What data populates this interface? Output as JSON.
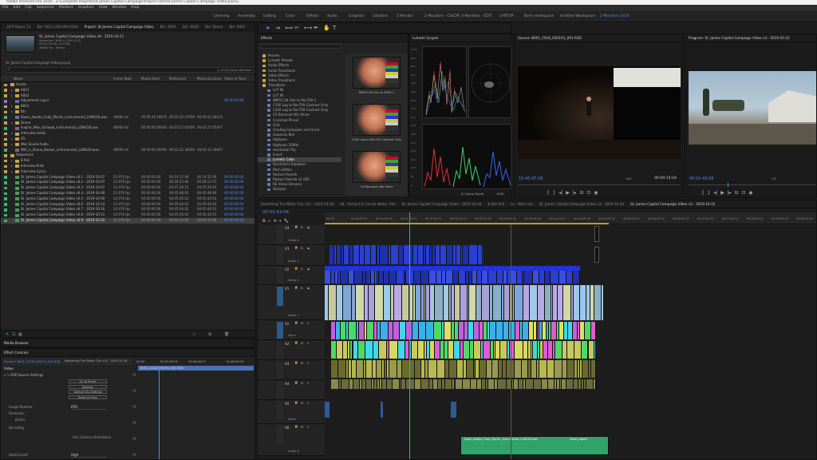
{
  "window": {
    "title": "Adobe Premiere Pro 2019 - Z:\\Complete Projects\\St James Capital Campaign\\Project Files\\St James Capital Campaign Video.prproj"
  },
  "menu": [
    "File",
    "Edit",
    "Clip",
    "Sequence",
    "Markers",
    "Graphics",
    "View",
    "Window",
    "Help"
  ],
  "workspaces": [
    {
      "label": "Learning",
      "active": false
    },
    {
      "label": "Assembly",
      "active": false
    },
    {
      "label": "Editing",
      "active": false
    },
    {
      "label": "Color",
      "active": false
    },
    {
      "label": "Effects",
      "active": false
    },
    {
      "label": "Audio",
      "active": false
    },
    {
      "label": "Graphics",
      "active": false
    },
    {
      "label": "Libraries",
      "active": false
    },
    {
      "label": "2 Monitor",
      "active": false
    },
    {
      "label": "2 Monitors - COLOR",
      "active": false
    },
    {
      "label": "3 Monitors - EDIT",
      "active": false
    },
    {
      "label": "LAPTOP",
      "active": false
    },
    {
      "label": "Tom's workspace",
      "active": false
    },
    {
      "label": "Untitled Workspace",
      "active": false
    },
    {
      "label": "2 Monitors 2019",
      "active": true
    }
  ],
  "project": {
    "tabs": [
      "...DCP Reduc 12",
      "Bin: A012_0913XH 0356",
      "Project: St James Capital Campaign Video",
      "Bin: A001",
      "Bin: A002",
      "Bin: Drone",
      "Bin: 0001"
    ],
    "active_tab": "Project: St James Capital Campaign Video",
    "preview_title": "St. James Capital Campaign Video v8 - 2019-10-21",
    "preview_info": [
      "Sequence, 3840 x 2160 (1.0)",
      "00:02:43:06, 23.976p",
      "48000 Hz - Stereo"
    ],
    "file_name": "St. James Capital Campaign Video.prproj",
    "count": "1 of 24 items selected",
    "headers": [
      "Name",
      "Frame Rate",
      "Media Start",
      "Media End",
      "Media Duration",
      "Video In Point"
    ],
    "rows": [
      {
        "name": "Assets",
        "type": "folder",
        "color": "#c9a24a",
        "indent": 0,
        "fr": "",
        "ms": "",
        "me": "",
        "md": "",
        "vi": ""
      },
      {
        "name": "A001",
        "type": "folder",
        "color": "#c9a24a",
        "indent": 1,
        "fr": "",
        "ms": "",
        "me": "",
        "md": "",
        "vi": ""
      },
      {
        "name": "A002",
        "type": "folder",
        "color": "#c9a24a",
        "indent": 1,
        "fr": "",
        "ms": "",
        "me": "",
        "md": "",
        "vi": ""
      },
      {
        "name": "Adjustment Layer",
        "type": "clip",
        "color": "#8b72c9",
        "indent": 1,
        "fr": "",
        "ms": "",
        "me": "",
        "md": "",
        "vi": "00:00:00:00"
      },
      {
        "name": "B001",
        "type": "folder",
        "color": "#c9a24a",
        "indent": 1,
        "fr": "",
        "ms": "",
        "me": "",
        "md": "",
        "vi": ""
      },
      {
        "name": "Bts",
        "type": "folder",
        "color": "#c9a24a",
        "indent": 1,
        "fr": "",
        "ms": "",
        "me": "",
        "md": "",
        "vi": ""
      },
      {
        "name": "Dawn_Awaits_Cody_Martin_instrumental_LONG29.wav",
        "type": "clip",
        "color": "#3bb56f",
        "indent": 1,
        "fr": "48000 Hz",
        "ms": "00:00:19:18870",
        "me": "00:03:12:47099",
        "md": "00:04:52:28124",
        "vi": ""
      },
      {
        "name": "Drone",
        "type": "folder",
        "color": "#c9a24a",
        "indent": 1,
        "fr": "",
        "ms": "",
        "me": "",
        "md": "",
        "vi": ""
      },
      {
        "name": "Inspire_Mike_Schwab_instrumental_LONG28.wav",
        "type": "clip",
        "color": "#3bb56f",
        "indent": 1,
        "fr": "48000 Hz",
        "ms": "00:00:00:00000",
        "me": "00:03:27:05406",
        "md": "00:03:27:05407",
        "vi": ""
      },
      {
        "name": "Interview Audio",
        "type": "folder",
        "color": "#c9a24a",
        "indent": 1,
        "fr": "",
        "ms": "",
        "me": "",
        "md": "",
        "vi": ""
      },
      {
        "name": "LTs",
        "type": "folder",
        "color": "#c9a24a",
        "indent": 1,
        "fr": "",
        "ms": "",
        "me": "",
        "md": "",
        "vi": ""
      },
      {
        "name": "Wes Sound Audio",
        "type": "folder",
        "color": "#c9a24a",
        "indent": 1,
        "fr": "",
        "ms": "",
        "me": "",
        "md": "",
        "vi": ""
      },
      {
        "name": "Will_in_Shane_Barber_instrumental_LONG29.wav",
        "type": "clip",
        "color": "#3bb56f",
        "indent": 1,
        "fr": "48000 Hz",
        "ms": "00:00:00:00000",
        "me": "00:03:15:36666",
        "md": "00:03:15:36667",
        "vi": ""
      },
      {
        "name": "Sequences",
        "type": "folder",
        "color": "#c9a24a",
        "indent": 0,
        "fr": "",
        "ms": "",
        "me": "",
        "md": "",
        "vi": ""
      },
      {
        "name": "B Roll",
        "type": "folder",
        "color": "#c9a24a",
        "indent": 1,
        "fr": "",
        "ms": "",
        "me": "",
        "md": "",
        "vi": ""
      },
      {
        "name": "Interview Pulls",
        "type": "folder",
        "color": "#c9a24a",
        "indent": 1,
        "fr": "",
        "ms": "",
        "me": "",
        "md": "",
        "vi": ""
      },
      {
        "name": "Interview Syncs",
        "type": "folder",
        "color": "#c9a24a",
        "indent": 1,
        "fr": "",
        "ms": "",
        "me": "",
        "md": "",
        "vi": ""
      },
      {
        "name": "St. James Capital Campaign Video v0.1 - 2019-10-07",
        "type": "seq",
        "color": "#3bb56f",
        "indent": 1,
        "fr": "23.976 fps",
        "ms": "00:00:00:00",
        "me": "00:14:15:08",
        "md": "00:14:15:09",
        "vi": "00:00:00:00"
      },
      {
        "name": "St. James Capital Campaign Video v0.2 - 2019-10-07",
        "type": "seq",
        "color": "#3bb56f",
        "indent": 1,
        "fr": "23.976 fps",
        "ms": "00:00:00:00",
        "me": "00:09:22:06",
        "md": "00:09:22:07",
        "vi": "00:00:00:00"
      },
      {
        "name": "St. James Capital Campaign Video v0.3 - 2019-10-07",
        "type": "seq",
        "color": "#3bb56f",
        "indent": 1,
        "fr": "23.976 fps",
        "ms": "00:00:00:00",
        "me": "00:07:29:15",
        "md": "00:07:29:16",
        "vi": "00:00:00:00"
      },
      {
        "name": "St. James Capital Campaign Video v0.4 - 2019-10-09",
        "type": "seq",
        "color": "#3bb56f",
        "indent": 1,
        "fr": "23.976 fps",
        "ms": "00:00:00:00",
        "me": "00:05:48:05",
        "md": "00:05:48:06",
        "vi": "00:00:00:00"
      },
      {
        "name": "St. James Capital Campaign Video v0.5 - 2019-10-09",
        "type": "seq",
        "color": "#3bb56f",
        "indent": 1,
        "fr": "23.976 fps",
        "ms": "00:00:00:00",
        "me": "00:05:44:02",
        "md": "00:05:44:03",
        "vi": "00:00:00:00"
      },
      {
        "name": "St. James Capital Campaign Video v0.6 - 2019-10-14",
        "type": "seq",
        "color": "#3bb56f",
        "indent": 1,
        "fr": "23.976 fps",
        "ms": "00:00:00:00",
        "me": "00:05:44:02",
        "md": "00:05:44:03",
        "vi": "00:00:00:00"
      },
      {
        "name": "St. James Capital Campaign Video v0.7 - 2019-10-16",
        "type": "seq",
        "color": "#3bb56f",
        "indent": 1,
        "fr": "23.976 fps",
        "ms": "00:00:00:00",
        "me": "00:05:44:02",
        "md": "00:05:44:03",
        "vi": "00:00:00:00"
      },
      {
        "name": "St. James Capital Campaign Video v0.8 - 2019-10-21",
        "type": "seq",
        "color": "#3bb56f",
        "indent": 1,
        "fr": "23.976 fps",
        "ms": "00:00:00:00",
        "me": "00:05:44:02",
        "md": "00:05:44:03",
        "vi": "00:00:00:00"
      },
      {
        "name": "St. James Capital Campaign Video v0.9 - 2019-10-22",
        "type": "seq",
        "color": "#3bb56f",
        "indent": 1,
        "fr": "23.976 fps",
        "ms": "00:00:00:00",
        "me": "00:02:43:05",
        "md": "00:02:43:06",
        "vi": "00:00:00:00",
        "selected": true
      }
    ]
  },
  "media_browser": {
    "tab": "Media Browser"
  },
  "effect_controls": {
    "tab": "Effect Controls",
    "source": "Source • B001_C016_0301H1_001.R3D",
    "sequence": "Restarting The Motor City v15 - 2019-10-18",
    "timecodes": [
      "00:00",
      "00:00:03:05",
      "15:46:00:07",
      "15:46:03:03"
    ],
    "clip_bar": "B001_C016_0301H1_001.R3D",
    "section": "Video",
    "fx": "R3D Source Settings",
    "buttons": [
      "Go To Preset",
      "Settings",
      "Default Clip Settings",
      "Reset All Clips"
    ],
    "params": [
      {
        "label": "Image Pipeline",
        "value": "IPP2"
      },
      {
        "label": "Demosaic",
        "value": ""
      },
      {
        "label": "Detail",
        "value": ""
      },
      {
        "label": "Decoding",
        "value": ""
      },
      {
        "label": "Use Camera Orientation",
        "value": ""
      },
      {
        "label": "Detail Level",
        "value": "High"
      }
    ]
  },
  "effects": {
    "tab": "Effects",
    "tree": [
      "Presets",
      "Lumetri Presets",
      "Audio Effects",
      "Audio Transitions",
      "Video Effects",
      "Video Transitions",
      "Transitions",
      "LUT IN",
      "LUT IN",
      "BMPCC4K Film to Rec709 2",
      "C300 Log to Rec709 Contrast Only",
      "C300 Log to Rec709 Contrast Only",
      "CA Removal Alfa Shine",
      "Crosshair Pinner",
      "Grid",
      "Grading Computer and Grind",
      "Gaussian Blur",
      "Highpass",
      "Highpass 200Hz",
      "Horizontal Flip",
      "Invert",
      "Lumetri Color",
      "Parametric Equalizer",
      "Pitch Shifter",
      "Reduce Reverb",
      "Reduce Reverb v2 (SR)",
      "RE Vision Denoise",
      "Sharpen"
    ],
    "selected": "Lumetri Color",
    "presets": [
      "BMPCC4K Film to 8709 2",
      "C300 Log to Rec709 Contrast Only",
      "CA Removal Alfa Shine"
    ]
  },
  "scopes": {
    "tab": "Lumetri Scopes",
    "clamp": "Clamp Signal",
    "bits": "8 Bit",
    "scale": [
      1023,
      960,
      896,
      832,
      768,
      704,
      640,
      576,
      512,
      448,
      384,
      320,
      256,
      192,
      128,
      64,
      0
    ]
  },
  "source_monitor": {
    "tab": "Source: B001_C016_0301H1_001.R3D",
    "timecode": "15:45:47:28",
    "fit": "Full",
    "duration": "00:00:14:04"
  },
  "program_monitor": {
    "tab": "Program: St. James Capital Campaign Video v3 - 2019-10-22",
    "timecode": "00:01:43:06",
    "ratio": "1/2",
    "duration": "00:02:43:06"
  },
  "timeline": {
    "tabs": [
      "Restarting The Motor City v15 - 2019-10-18",
      "04 - Richard & Connie Motor, Pull",
      "St. James Capital Campaign Video - 2019-10-20",
      "B Roll Pull",
      "xx - Main vox",
      "St. James Capital Campaign Video v3 - 2019-10-20",
      "St. James Capital Campaign Video v3 - 2019-10-22"
    ],
    "active_tab": "St. James Capital Campaign Video v3 - 2019-10-22",
    "timecode": "00:01:43:06",
    "ruler": [
      "00:00",
      "00:00:29:22",
      "00:00:59:22",
      "00:01:29:21",
      "00:01:59:21",
      "00:02:29:20",
      "00:02:59:19",
      "00:03:29:18",
      "00:03:59:18",
      "00:04:29:17",
      "00:04:59:16",
      "00:05:29:16",
      "00:05:59:15",
      "00:06:29:14",
      "00:06:59:13",
      "00:07:29:12",
      "00:07:59:12",
      "00:08:29:11",
      "00:08:59:10",
      "00:09:29:09"
    ],
    "tracks": [
      "V4",
      "V3",
      "V2",
      "V1",
      "A1",
      "A2",
      "A3",
      "A4",
      "A5",
      "A6"
    ],
    "track_names": [
      "Video 4",
      "Video 3",
      "Video 2",
      "Video 1",
      "Voice",
      "",
      "",
      "",
      "Music",
      "Audio 6"
    ],
    "music_clip": "Dawn_Awaits_Cody_Martin_instrumental_LONG29.wav",
    "music_clip2": "Dawn_Awaits"
  }
}
